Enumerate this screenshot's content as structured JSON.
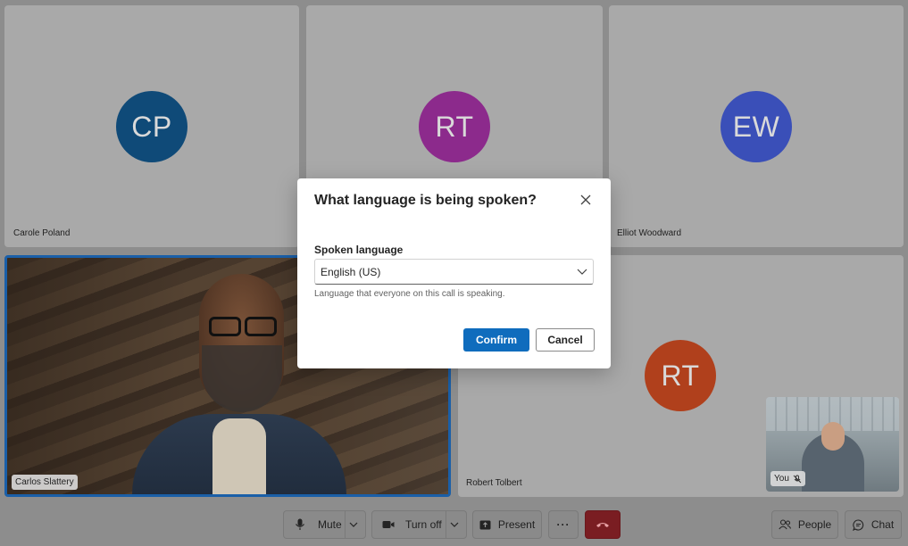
{
  "participants": [
    {
      "name": "Carole Poland",
      "initials": "CP",
      "color": "#0f4a78"
    },
    {
      "name": "RT",
      "initials": "RT",
      "color": "#8c2a8c"
    },
    {
      "name": "Elliot Woodward",
      "initials": "EW",
      "color": "#3a4fb8"
    },
    {
      "name": "Carlos Slattery"
    },
    {
      "name": "Robert Tolbert",
      "initials": "RT",
      "color": "#b0401c"
    }
  ],
  "self_view": {
    "label": "You"
  },
  "toolbar": {
    "mute_label": "Mute",
    "camera_label": "Turn off",
    "present_label": "Present",
    "more_label": "···",
    "people_label": "People",
    "chat_label": "Chat"
  },
  "dialog": {
    "title": "What language is being spoken?",
    "field_label": "Spoken language",
    "selected_language": "English (US)",
    "hint": "Language that everyone on this call is speaking.",
    "confirm_label": "Confirm",
    "cancel_label": "Cancel"
  },
  "colors": {
    "accent": "#0f6cbd",
    "hangup": "#7a1d22",
    "active_speaker_border": "#1a5fa8"
  }
}
